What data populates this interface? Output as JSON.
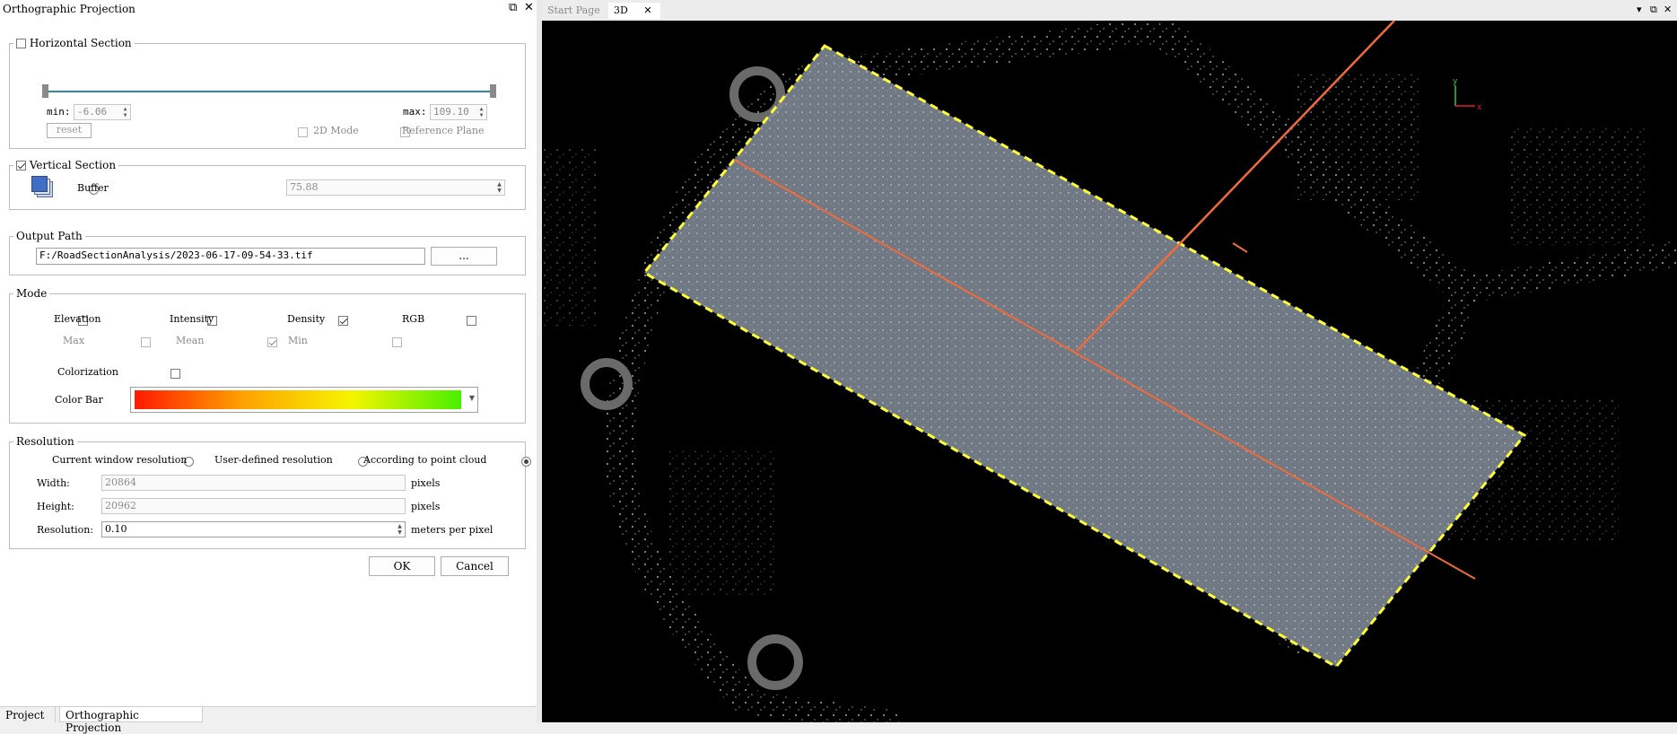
{
  "panel": {
    "title": "Orthographic Projection",
    "float_icon": "⧉",
    "close_icon": "✕"
  },
  "horizontal_section": {
    "label": "Horizontal Section",
    "checked": false,
    "min_label": "min:",
    "min_value": "-6.06",
    "max_label": "max:",
    "max_value": "109.10",
    "reset_label": "reset",
    "mode2d_label": "2D Mode",
    "reference_plane_label": "Reference Plane"
  },
  "vertical_section": {
    "label": "Vertical Section",
    "checked": true,
    "buffer_label": "Buffer",
    "buffer_value": "75.88"
  },
  "output_path": {
    "legend": "Output Path",
    "value": "F:/RoadSectionAnalysis/2023-06-17-09-54-33.tif",
    "browse_label": "..."
  },
  "mode": {
    "legend": "Mode",
    "elevation": "Elevation",
    "intensity": "Intensity",
    "density": "Density",
    "rgb": "RGB",
    "max": "Max",
    "mean": "Mean",
    "min": "Min",
    "colorization": "Colorization",
    "color_bar": "Color Bar",
    "color_bar_colors": [
      "#ff1a00",
      "#ffa200",
      "#f5f500",
      "#48f000"
    ]
  },
  "resolution": {
    "legend": "Resolution",
    "opt_current": "Current window resolution",
    "opt_user": "User-defined resolution",
    "opt_cloud": "According to point cloud",
    "width_label": "Width:",
    "width_value": "20864",
    "height_label": "Height:",
    "height_value": "20962",
    "pixels": "pixels",
    "res_label": "Resolution:",
    "res_value": "0.10",
    "res_unit": "meters per pixel"
  },
  "buttons": {
    "ok": "OK",
    "cancel": "Cancel"
  },
  "bottom_tabs": [
    "Project",
    "Orthographic Projection"
  ],
  "right_tabs": {
    "start_page": "Start Page",
    "view3d": "3D",
    "close_icon": "✕",
    "menu_icon": "▾",
    "float_icon": "⧉"
  },
  "axis": {
    "y_label": "y",
    "x_label": "x",
    "y_color": "#2ecc40",
    "x_color": "#e02020"
  },
  "colors": {
    "selection_outline": "#ffff33",
    "section_line": "#f06a3a",
    "slider_track": "#2a8a9a"
  }
}
